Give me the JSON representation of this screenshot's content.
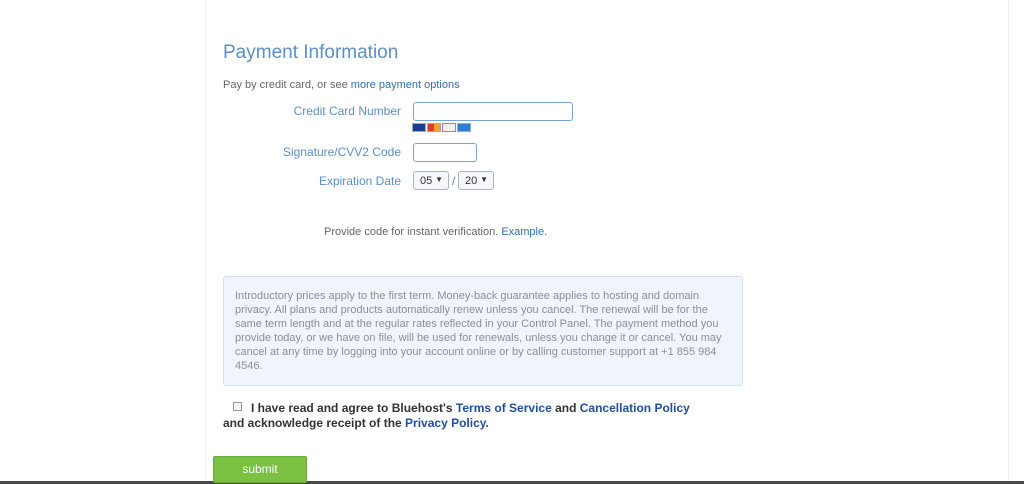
{
  "header": {
    "title": "Payment Information",
    "subtitle_text": "Pay by credit card, or see ",
    "subtitle_link": "more payment options"
  },
  "form": {
    "credit_card_label": "Credit Card Number",
    "credit_card_value": "",
    "card_logos": [
      "visa-icon",
      "mastercard-icon",
      "discover-icon",
      "amex-icon"
    ],
    "cvv_label": "Signature/CVV2 Code",
    "cvv_value": "",
    "expiration_label": "Expiration Date",
    "expiration_month": "05",
    "expiration_separator": "/",
    "expiration_year": "20",
    "verify_text": "Provide code for instant verification. ",
    "verify_link": "Example."
  },
  "notice": {
    "text": "Introductory prices apply to the first term. Money-back guarantee applies to hosting and domain privacy. All plans and products automatically renew unless you cancel. The renewal will be for the same term length and at the regular rates reflected in your Control Panel. The payment method you provide today, or we have on file, will be used for renewals, unless you change it or cancel. You may cancel at any time by logging into your account online or by calling customer support at +1 855 984 4546."
  },
  "agreement": {
    "text_1": "I have read and agree to Bluehost's ",
    "tos_link": "Terms of Service",
    "text_2": " and ",
    "cancellation_link": "Cancellation Policy",
    "text_3": " and acknowledge receipt of the ",
    "privacy_link": "Privacy Policy.",
    "checked": false
  },
  "actions": {
    "submit_label": "submit"
  },
  "colors": {
    "accent": "#5b8fc6",
    "link": "#2f6fb3",
    "submit_green": "#7ac142"
  }
}
